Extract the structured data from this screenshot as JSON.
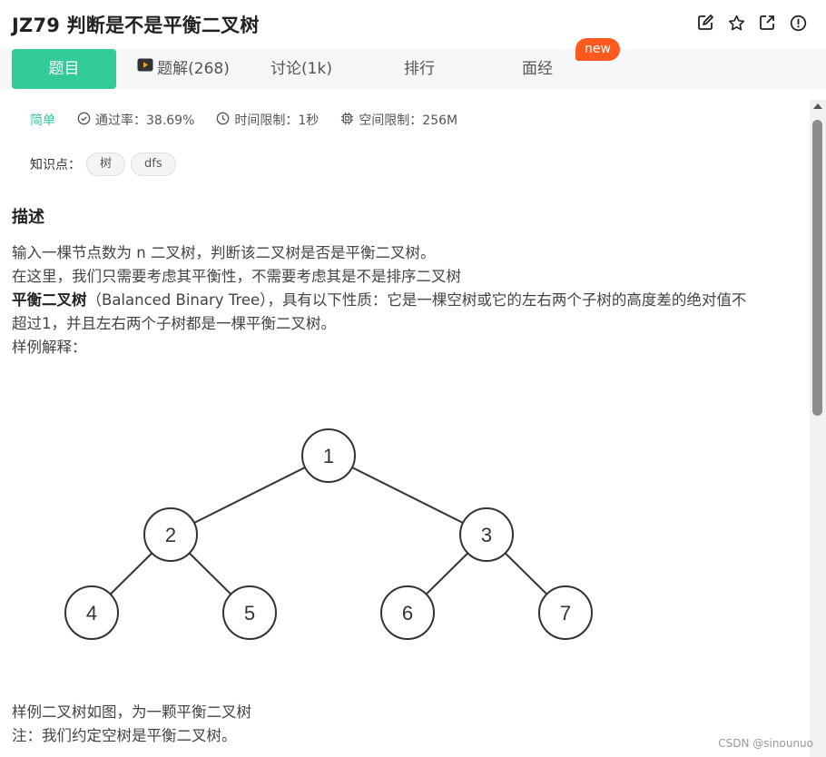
{
  "header": {
    "title": "JZ79  判断是不是平衡二叉树",
    "actions": [
      "edit-icon",
      "star-icon",
      "share-icon",
      "report-icon"
    ]
  },
  "tabs": [
    {
      "label": "题目",
      "active": true
    },
    {
      "label": "题解(268)",
      "icon": "video-icon"
    },
    {
      "label": "讨论(1k)"
    },
    {
      "label": "排行"
    },
    {
      "label": "面经"
    }
  ],
  "new_badge": "new",
  "meta": {
    "difficulty": "简单",
    "pass_rate": "通过率：38.69%",
    "time_limit": "时间限制：1秒",
    "space_limit": "空间限制：256M"
  },
  "knowledge": {
    "label": "知识点：",
    "tags": [
      "树",
      "dfs"
    ]
  },
  "description": {
    "heading": "描述",
    "line1": "输入一棵节点数为 n 二叉树，判断该二叉树是否是平衡二叉树。",
    "line2": "在这里，我们只需要考虑其平衡性，不需要考虑其是不是排序二叉树",
    "line3_bold": "平衡二叉树",
    "line3_rest": "（Balanced Binary Tree），具有以下性质：它是一棵空树或它的左右两个子树的高度差的绝对值不",
    "line4": "超过1，并且左右两个子树都是一棵平衡二叉树。",
    "line5": "样例解释："
  },
  "tree": {
    "nodes": [
      "1",
      "2",
      "3",
      "4",
      "5",
      "6",
      "7"
    ]
  },
  "footer": {
    "line1": "样例二叉树如图，为一颗平衡二叉树",
    "line2": "注：我们约定空树是平衡二叉树。"
  },
  "watermark": "CSDN @sinounuo",
  "colors": {
    "accent": "#32ca99",
    "badge": "#fe5a1f",
    "tab_bar": "#f5f6f8"
  }
}
